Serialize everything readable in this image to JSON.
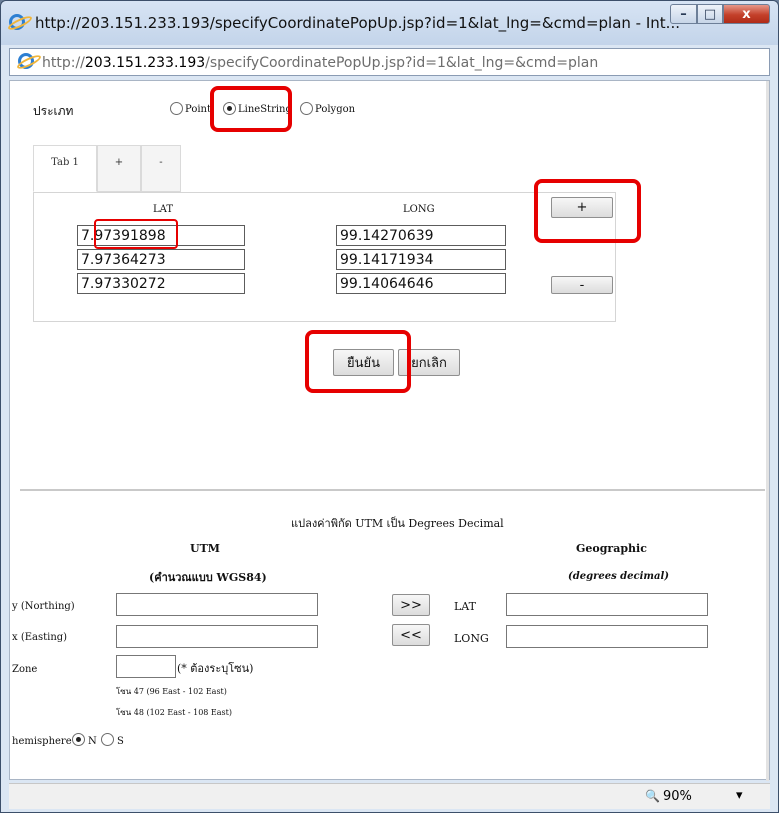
{
  "titlebar": {
    "title": "http://203.151.233.193/specifyCoordinatePopUp.jsp?id=1&lat_lng=&cmd=plan - Int...",
    "min": "–",
    "max": "□",
    "close": "x"
  },
  "address": {
    "prefix": "http://",
    "host": "203.151.233.193",
    "path": "/specifyCoordinatePopUp.jsp?id=1&lat_lng=&cmd=plan"
  },
  "form": {
    "type_label": "ประเภท",
    "type_options": [
      "Point",
      "LineString",
      "Polygon"
    ],
    "tabs": [
      "Tab 1",
      "+",
      "-"
    ],
    "lat_header": "LAT",
    "long_header": "LONG",
    "rows": [
      {
        "lat": "7.97391898",
        "long": "99.14270639"
      },
      {
        "lat": "7.97364273",
        "long": "99.14171934"
      },
      {
        "lat": "7.97330272",
        "long": "99.14064646"
      }
    ],
    "add_row": "+",
    "remove_row": "-",
    "confirm": "ยืนยัน",
    "cancel": "ยกเลิก"
  },
  "converter": {
    "title": "แปลงค่าพิกัด UTM เป็น Degrees Decimal",
    "utm_heading": "UTM",
    "utm_sub": "(คำนวณแบบ WGS84)",
    "geo_heading": "Geographic",
    "geo_sub": "(degrees decimal)",
    "northing_label": "y (Northing)",
    "easting_label": "x (Easting)",
    "to_geo_button": ">>",
    "to_utm_button": "<<",
    "lat_label": "LAT",
    "long_label": "LONG",
    "zone_label": "Zone",
    "zone_required": "(* ต้องระบุโซน)",
    "zone47": "โซน 47 (96 East - 102 East)",
    "zone48": "โซน 48 (102 East - 108 East)",
    "hemisphere_label": "hemisphere",
    "hemisphere_options": [
      "N",
      "S"
    ]
  },
  "status": {
    "zoom": "90%",
    "zoom_menu": "▾"
  },
  "colors": {
    "highlight": "#e60000",
    "title_bg": "#c9d9ee"
  }
}
